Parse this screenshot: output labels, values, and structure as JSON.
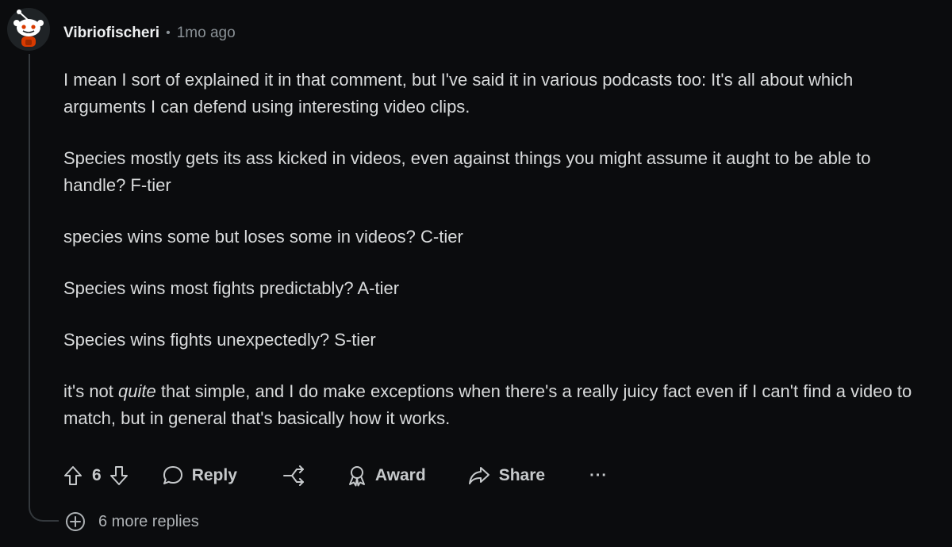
{
  "comment": {
    "username": "Vibriofischeri",
    "separator": "•",
    "timestamp": "1mo ago",
    "paragraphs": [
      "I mean I sort of explained it in that comment, but I've said it in various podcasts too: It's all about which arguments I can defend using interesting video clips.",
      "Species mostly gets its ass kicked in videos, even against things you might assume it aught to be able to handle? F-tier",
      "species wins some but loses some in videos? C-tier",
      "Species wins most fights predictably? A-tier",
      "Species wins fights unexpectedly? S-tier"
    ],
    "last_paragraph": {
      "before": "it's not ",
      "emphasis": "quite",
      "after": " that simple, and I do make exceptions when there's a really juicy fact even if I can't find a video to match, but in general that's basically how it works."
    }
  },
  "actions": {
    "vote_count": "6",
    "reply_label": "Reply",
    "award_label": "Award",
    "share_label": "Share",
    "more_label": "···"
  },
  "more_replies": {
    "label": "6 more replies"
  },
  "icons": {
    "avatar": "reddit-snoo-avatar-icon",
    "upvote": "upvote-arrow-icon",
    "downvote": "downvote-arrow-icon",
    "reply": "speech-bubble-icon",
    "crosspost": "crosspost-icon",
    "award": "award-ribbon-icon",
    "share": "share-arrow-icon",
    "expand": "plus-circle-icon"
  },
  "colors": {
    "background": "#0b0c0e",
    "text": "#d9dbdc",
    "muted": "#8a9196",
    "snoo_accent": "#d93a00"
  }
}
